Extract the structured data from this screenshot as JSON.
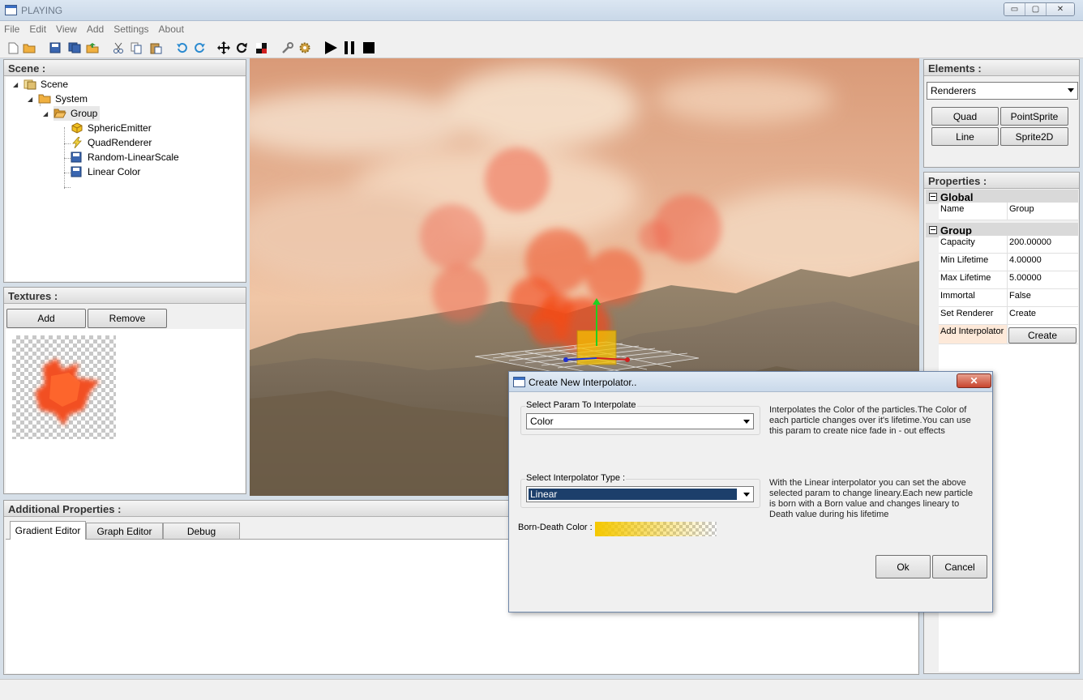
{
  "window": {
    "title": "PLAYING",
    "controls": {
      "minimize": "▭",
      "maximize": "▢",
      "close": "✕"
    }
  },
  "menu": [
    "File",
    "Edit",
    "View",
    "Add",
    "Settings",
    "About"
  ],
  "toolbar": {
    "icons": [
      "new-file-icon",
      "open-folder-icon",
      "save-icon",
      "save-all-icon",
      "export-icon",
      "cut-icon",
      "copy-icon",
      "paste-icon",
      "undo-icon",
      "redo-icon",
      "move-icon",
      "rotate-icon",
      "scale-icon",
      "tools-icon",
      "settings-icon",
      "play-icon",
      "pause-icon",
      "stop-icon"
    ]
  },
  "scene": {
    "header": "Scene :",
    "tree": [
      {
        "label": "Scene",
        "icon": "scene-icon",
        "level": 0
      },
      {
        "label": "System",
        "icon": "folder-icon",
        "level": 1
      },
      {
        "label": "Group",
        "icon": "open-folder-icon",
        "level": 2
      },
      {
        "label": "SphericEmitter",
        "icon": "emitter-cube-icon",
        "level": 3
      },
      {
        "label": "QuadRenderer",
        "icon": "lightning-icon",
        "level": 3
      },
      {
        "label": "Random-LinearScale",
        "icon": "disk-icon",
        "level": 3
      },
      {
        "label": "Linear Color",
        "icon": "disk-icon",
        "level": 3
      }
    ]
  },
  "textures": {
    "header": "Textures :",
    "add_label": "Add",
    "remove_label": "Remove"
  },
  "elements": {
    "header": "Elements :",
    "dropdown_value": "Renderers",
    "buttons": [
      "Quad",
      "PointSprite",
      "Line",
      "Sprite2D"
    ]
  },
  "properties": {
    "header": "Properties :",
    "global": {
      "title": "Global",
      "rows": [
        {
          "k": "Name",
          "v": "Group"
        }
      ]
    },
    "group": {
      "title": "Group",
      "rows": [
        {
          "k": "Capacity",
          "v": "200.00000"
        },
        {
          "k": "Min Lifetime",
          "v": "4.00000"
        },
        {
          "k": "Max Lifetime",
          "v": "5.00000"
        },
        {
          "k": "Immortal",
          "v": "False"
        },
        {
          "k": "Set Renderer",
          "v": "Create"
        }
      ],
      "add_interpolator_label": "Add Interpolator",
      "create_button": "Create"
    }
  },
  "additional": {
    "header": "Additional Properties :",
    "tabs": [
      "Gradient Editor",
      "Graph Editor",
      "Debug"
    ]
  },
  "dialog": {
    "title": "Create New Interpolator..",
    "close": "✕",
    "param_group_label": "Select Param To Interpolate",
    "param_value": "Color",
    "param_desc": "Interpolates the Color of the particles.The Color of each particle changes over it's lifetime.You can use this param to create nice fade in - out effects",
    "type_group_label": "Select Interpolator Type :",
    "type_value": "Linear",
    "type_desc": "With the Linear interpolator you can set the above selected param to change lineary.Each new particle is born with a Born value and changes lineary to Death value during his lifetime",
    "born_death_label": "Born-Death Color :",
    "gradient_color": "#f5c800",
    "ok_label": "Ok",
    "cancel_label": "Cancel"
  }
}
